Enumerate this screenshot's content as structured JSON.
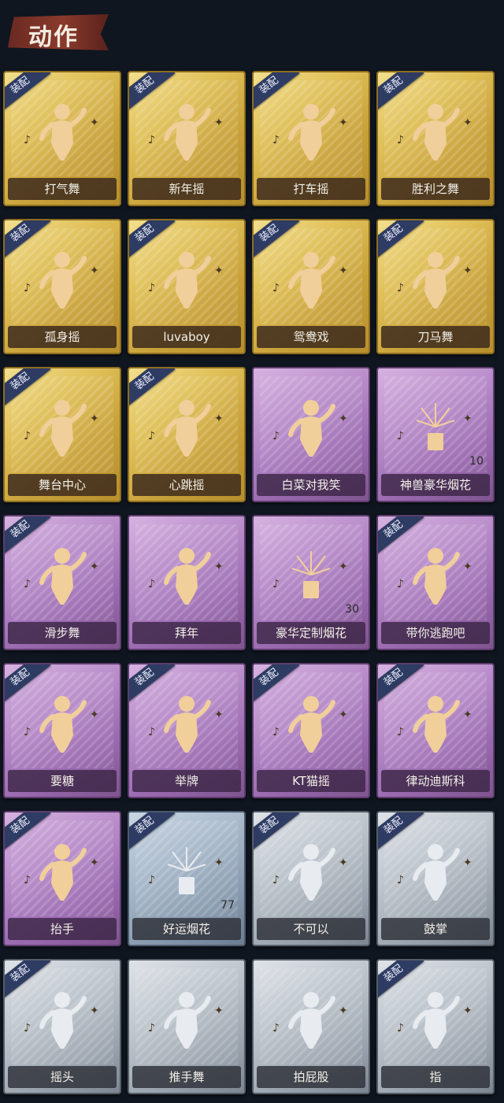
{
  "header": {
    "title": "动作"
  },
  "badge_label": "装配",
  "colors": {
    "gold": "#c9a23a",
    "purple": "#9a6ab0",
    "gray": "#9aa3ad",
    "bluegray": "#8597ab"
  },
  "cards": [
    {
      "label": "打气舞",
      "tier": "gold",
      "equipped": true,
      "icon": "dance-figure-icon"
    },
    {
      "label": "新年摇",
      "tier": "gold",
      "equipped": true,
      "icon": "dance-figure-icon"
    },
    {
      "label": "打车摇",
      "tier": "gold",
      "equipped": true,
      "icon": "dance-figure-icon"
    },
    {
      "label": "胜利之舞",
      "tier": "gold",
      "equipped": true,
      "icon": "dance-figure-icon"
    },
    {
      "label": "孤身摇",
      "tier": "gold",
      "equipped": true,
      "icon": "dance-figure-icon"
    },
    {
      "label": "luvaboy",
      "tier": "gold",
      "equipped": true,
      "icon": "dance-figure-icon"
    },
    {
      "label": "鸳鸯戏",
      "tier": "gold",
      "equipped": true,
      "icon": "dance-figure-icon"
    },
    {
      "label": "刀马舞",
      "tier": "gold",
      "equipped": true,
      "icon": "dance-figure-icon"
    },
    {
      "label": "舞台中心",
      "tier": "gold",
      "equipped": true,
      "icon": "dance-figure-icon"
    },
    {
      "label": "心跳摇",
      "tier": "gold",
      "equipped": true,
      "icon": "dance-figure-icon"
    },
    {
      "label": "白菜对我笑",
      "tier": "purple",
      "equipped": false,
      "icon": "dance-figure-icon"
    },
    {
      "label": "神兽豪华烟花",
      "tier": "purple",
      "equipped": false,
      "icon": "fireworks-icon",
      "count": "10"
    },
    {
      "label": "滑步舞",
      "tier": "purple",
      "equipped": true,
      "icon": "dance-figure-icon"
    },
    {
      "label": "拜年",
      "tier": "purple",
      "equipped": false,
      "icon": "bow-figure-icon"
    },
    {
      "label": "豪华定制烟花",
      "tier": "purple",
      "equipped": false,
      "icon": "fireworks-icon",
      "count": "30"
    },
    {
      "label": "带你逃跑吧",
      "tier": "purple",
      "equipped": true,
      "icon": "dance-figure-icon"
    },
    {
      "label": "要糖",
      "tier": "purple",
      "equipped": true,
      "icon": "reach-figure-icon"
    },
    {
      "label": "举牌",
      "tier": "purple",
      "equipped": true,
      "icon": "sign-figure-icon"
    },
    {
      "label": "KT猫摇",
      "tier": "purple",
      "equipped": true,
      "icon": "dance-figure-icon"
    },
    {
      "label": "律动迪斯科",
      "tier": "purple",
      "equipped": true,
      "icon": "dance-figure-icon"
    },
    {
      "label": "抬手",
      "tier": "purple",
      "equipped": true,
      "icon": "raise-hand-figure-icon"
    },
    {
      "label": "好运烟花",
      "tier": "bluegray",
      "equipped": true,
      "icon": "firecracker-icon",
      "count": "77"
    },
    {
      "label": "不可以",
      "tier": "gray",
      "equipped": true,
      "icon": "finger-wag-icon"
    },
    {
      "label": "鼓掌",
      "tier": "gray",
      "equipped": true,
      "icon": "clap-hands-icon"
    },
    {
      "label": "摇头",
      "tier": "gray",
      "equipped": true,
      "icon": "shake-head-figure-icon"
    },
    {
      "label": "推手舞",
      "tier": "gray",
      "equipped": false,
      "icon": "push-hands-figure-icon"
    },
    {
      "label": "拍屁股",
      "tier": "gray",
      "equipped": false,
      "icon": "spank-figure-icon"
    },
    {
      "label": "指",
      "tier": "gray",
      "equipped": true,
      "icon": "point-hand-icon"
    }
  ]
}
